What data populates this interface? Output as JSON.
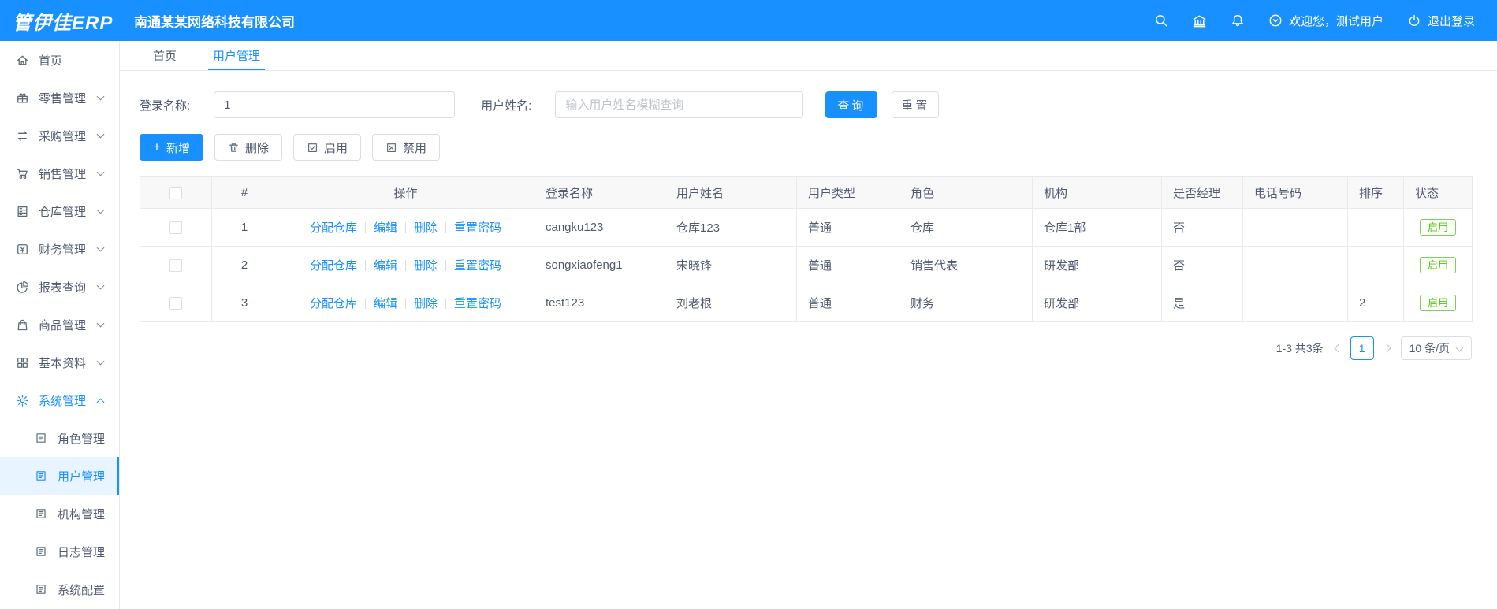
{
  "header": {
    "logo": "管伊佳ERP",
    "company": "南通某某网络科技有限公司",
    "welcome": "欢迎您，测试用户",
    "logout": "退出登录",
    "icons": [
      "search-icon",
      "bank-icon",
      "bell-icon",
      "user-circle-icon",
      "power-icon"
    ]
  },
  "sidebar": {
    "items": [
      {
        "label": "首页",
        "icon": "home-icon"
      },
      {
        "label": "零售管理",
        "icon": "retail-icon"
      },
      {
        "label": "采购管理",
        "icon": "purchase-icon"
      },
      {
        "label": "销售管理",
        "icon": "sales-cart-icon"
      },
      {
        "label": "仓库管理",
        "icon": "warehouse-icon"
      },
      {
        "label": "财务管理",
        "icon": "finance-icon"
      },
      {
        "label": "报表查询",
        "icon": "report-pie-icon"
      },
      {
        "label": "商品管理",
        "icon": "goods-bag-icon"
      },
      {
        "label": "基本资料",
        "icon": "basic-grid-icon"
      },
      {
        "label": "系统管理",
        "icon": "system-gear-icon",
        "active": true,
        "expanded": true
      }
    ],
    "sub_items": [
      {
        "label": "角色管理",
        "icon": "doc-icon"
      },
      {
        "label": "用户管理",
        "icon": "doc-icon",
        "selected": true
      },
      {
        "label": "机构管理",
        "icon": "doc-icon"
      },
      {
        "label": "日志管理",
        "icon": "doc-icon"
      },
      {
        "label": "系统配置",
        "icon": "doc-icon"
      }
    ]
  },
  "tabs": [
    {
      "label": "首页",
      "active": false
    },
    {
      "label": "用户管理",
      "active": true
    }
  ],
  "filters": {
    "login_label": "登录名称:",
    "login_value": "1",
    "name_label": "用户姓名:",
    "name_placeholder": "输入用户姓名模糊查询",
    "search_label": "查询",
    "reset_label": "重置"
  },
  "toolbar": {
    "add": "新增",
    "delete": "删除",
    "enable": "启用",
    "disable": "禁用"
  },
  "table": {
    "headers": {
      "index": "#",
      "ops": "操作",
      "login": "登录名称",
      "name": "用户姓名",
      "type": "用户类型",
      "role": "角色",
      "org": "机构",
      "manager": "是否经理",
      "phone": "电话号码",
      "sort": "排序",
      "status": "状态"
    },
    "actions": [
      "分配仓库",
      "编辑",
      "删除",
      "重置密码"
    ],
    "rows": [
      {
        "index": "1",
        "login": "cangku123",
        "name": "仓库123",
        "type": "普通",
        "role": "仓库",
        "org": "仓库1部",
        "manager": "否",
        "phone": "",
        "sort": "",
        "status": "启用"
      },
      {
        "index": "2",
        "login": "songxiaofeng1",
        "name": "宋晓锋",
        "type": "普通",
        "role": "销售代表",
        "org": "研发部",
        "manager": "否",
        "phone": "",
        "sort": "",
        "status": "启用"
      },
      {
        "index": "3",
        "login": "test123",
        "name": "刘老根",
        "type": "普通",
        "role": "财务",
        "org": "研发部",
        "manager": "是",
        "phone": "",
        "sort": "2",
        "status": "启用"
      }
    ]
  },
  "pagination": {
    "total": "1-3 共3条",
    "page": "1",
    "page_size": "10 条/页"
  },
  "colors": {
    "primary": "#1890ff",
    "success": "#52c41a",
    "header_bg": "#1890ff",
    "selected_bg": "#e8f4ff",
    "border": "#e8eaec"
  }
}
